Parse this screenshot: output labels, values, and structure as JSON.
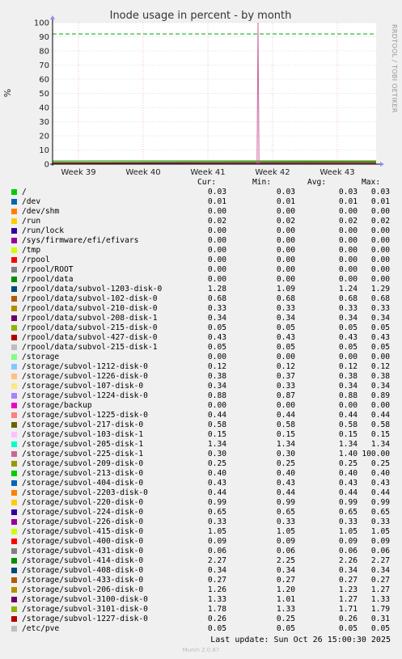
{
  "chart_data": {
    "type": "line",
    "title": "Inode usage in percent - by month",
    "ylabel": "%",
    "side_label": "RRDTOOL / TOBI OETIKER",
    "ylim": [
      0,
      100
    ],
    "yticks": [
      0,
      10,
      20,
      30,
      40,
      50,
      60,
      70,
      80,
      90,
      100
    ],
    "xlim": [
      0,
      100
    ],
    "x_ticks": [
      {
        "label": "Week 39",
        "x": 8
      },
      {
        "label": "Week 40",
        "x": 28
      },
      {
        "label": "Week 41",
        "x": 48
      },
      {
        "label": "Week 42",
        "x": 68
      },
      {
        "label": "Week 43",
        "x": 88
      }
    ],
    "warning_line": 92,
    "spike": {
      "x": 63.5,
      "y": 100
    }
  },
  "legend": {
    "headers": [
      "Cur:",
      "Min:",
      "Avg:",
      "Max:"
    ],
    "rows": [
      {
        "name": "/",
        "color": "#00cc00",
        "cur": "0.03",
        "min": "0.03",
        "avg": "0.03",
        "max": "0.03"
      },
      {
        "name": "/dev",
        "color": "#0066b3",
        "cur": "0.01",
        "min": "0.01",
        "avg": "0.01",
        "max": "0.01"
      },
      {
        "name": "/dev/shm",
        "color": "#ff8000",
        "cur": "0.00",
        "min": "0.00",
        "avg": "0.00",
        "max": "0.00"
      },
      {
        "name": "/run",
        "color": "#ffcc00",
        "cur": "0.02",
        "min": "0.02",
        "avg": "0.02",
        "max": "0.02"
      },
      {
        "name": "/run/lock",
        "color": "#330099",
        "cur": "0.00",
        "min": "0.00",
        "avg": "0.00",
        "max": "0.00"
      },
      {
        "name": "/sys/firmware/efi/efivars",
        "color": "#990099",
        "cur": "0.00",
        "min": "0.00",
        "avg": "0.00",
        "max": "0.00"
      },
      {
        "name": "/tmp",
        "color": "#ccff00",
        "cur": "0.00",
        "min": "0.00",
        "avg": "0.00",
        "max": "0.00"
      },
      {
        "name": "/rpool",
        "color": "#ff0000",
        "cur": "0.00",
        "min": "0.00",
        "avg": "0.00",
        "max": "0.00"
      },
      {
        "name": "/rpool/ROOT",
        "color": "#808080",
        "cur": "0.00",
        "min": "0.00",
        "avg": "0.00",
        "max": "0.00"
      },
      {
        "name": "/rpool/data",
        "color": "#008f00",
        "cur": "0.00",
        "min": "0.00",
        "avg": "0.00",
        "max": "0.00"
      },
      {
        "name": "/rpool/data/subvol-1203-disk-0",
        "color": "#00487d",
        "cur": "1.28",
        "min": "1.09",
        "avg": "1.24",
        "max": "1.29"
      },
      {
        "name": "/rpool/data/subvol-102-disk-0",
        "color": "#b35a00",
        "cur": "0.68",
        "min": "0.68",
        "avg": "0.68",
        "max": "0.68"
      },
      {
        "name": "/rpool/data/subvol-210-disk-0",
        "color": "#b38f00",
        "cur": "0.33",
        "min": "0.33",
        "avg": "0.33",
        "max": "0.33"
      },
      {
        "name": "/rpool/data/subvol-208-disk-1",
        "color": "#6b006b",
        "cur": "0.34",
        "min": "0.34",
        "avg": "0.34",
        "max": "0.34"
      },
      {
        "name": "/rpool/data/subvol-215-disk-0",
        "color": "#8fb300",
        "cur": "0.05",
        "min": "0.05",
        "avg": "0.05",
        "max": "0.05"
      },
      {
        "name": "/rpool/data/subvol-427-disk-0",
        "color": "#b30000",
        "cur": "0.43",
        "min": "0.43",
        "avg": "0.43",
        "max": "0.43"
      },
      {
        "name": "/rpool/data/subvol-215-disk-1",
        "color": "#bebebe",
        "cur": "0.05",
        "min": "0.05",
        "avg": "0.05",
        "max": "0.05"
      },
      {
        "name": "/storage",
        "color": "#80ff80",
        "cur": "0.00",
        "min": "0.00",
        "avg": "0.00",
        "max": "0.00"
      },
      {
        "name": "/storage/subvol-1212-disk-0",
        "color": "#80c9ff",
        "cur": "0.12",
        "min": "0.12",
        "avg": "0.12",
        "max": "0.12"
      },
      {
        "name": "/storage/subvol-1226-disk-0",
        "color": "#ffc080",
        "cur": "0.38",
        "min": "0.37",
        "avg": "0.38",
        "max": "0.38"
      },
      {
        "name": "/storage/subvol-107-disk-0",
        "color": "#ffe680",
        "cur": "0.34",
        "min": "0.33",
        "avg": "0.34",
        "max": "0.34"
      },
      {
        "name": "/storage/subvol-1224-disk-0",
        "color": "#aa80ff",
        "cur": "0.88",
        "min": "0.87",
        "avg": "0.88",
        "max": "0.89"
      },
      {
        "name": "/storage/backup",
        "color": "#ee00cc",
        "cur": "0.00",
        "min": "0.00",
        "avg": "0.00",
        "max": "0.00"
      },
      {
        "name": "/storage/subvol-1225-disk-0",
        "color": "#ff8080",
        "cur": "0.44",
        "min": "0.44",
        "avg": "0.44",
        "max": "0.44"
      },
      {
        "name": "/storage/subvol-217-disk-0",
        "color": "#666600",
        "cur": "0.58",
        "min": "0.58",
        "avg": "0.58",
        "max": "0.58"
      },
      {
        "name": "/storage/subvol-103-disk-1",
        "color": "#ffbfff",
        "cur": "0.15",
        "min": "0.15",
        "avg": "0.15",
        "max": "0.15"
      },
      {
        "name": "/storage/subvol-205-disk-1",
        "color": "#00ffcc",
        "cur": "1.34",
        "min": "1.34",
        "avg": "1.34",
        "max": "1.34"
      },
      {
        "name": "/storage/subvol-225-disk-1",
        "color": "#cc6699",
        "cur": "0.30",
        "min": "0.30",
        "avg": "1.40",
        "max": "100.00"
      },
      {
        "name": "/storage/subvol-209-disk-0",
        "color": "#999900",
        "cur": "0.25",
        "min": "0.25",
        "avg": "0.25",
        "max": "0.25"
      },
      {
        "name": "/storage/subvol-213-disk-0",
        "color": "#00cc00",
        "cur": "0.40",
        "min": "0.40",
        "avg": "0.40",
        "max": "0.40"
      },
      {
        "name": "/storage/subvol-404-disk-0",
        "color": "#0066b3",
        "cur": "0.43",
        "min": "0.43",
        "avg": "0.43",
        "max": "0.43"
      },
      {
        "name": "/storage/subvol-2203-disk-0",
        "color": "#ff8000",
        "cur": "0.44",
        "min": "0.44",
        "avg": "0.44",
        "max": "0.44"
      },
      {
        "name": "/storage/subvol-220-disk-0",
        "color": "#ffcc00",
        "cur": "0.99",
        "min": "0.99",
        "avg": "0.99",
        "max": "0.99"
      },
      {
        "name": "/storage/subvol-224-disk-0",
        "color": "#330099",
        "cur": "0.65",
        "min": "0.65",
        "avg": "0.65",
        "max": "0.65"
      },
      {
        "name": "/storage/subvol-226-disk-0",
        "color": "#990099",
        "cur": "0.33",
        "min": "0.33",
        "avg": "0.33",
        "max": "0.33"
      },
      {
        "name": "/storage/subvol-415-disk-0",
        "color": "#ccff00",
        "cur": "1.05",
        "min": "1.05",
        "avg": "1.05",
        "max": "1.05"
      },
      {
        "name": "/storage/subvol-400-disk-0",
        "color": "#ff0000",
        "cur": "0.09",
        "min": "0.09",
        "avg": "0.09",
        "max": "0.09"
      },
      {
        "name": "/storage/subvol-431-disk-0",
        "color": "#808080",
        "cur": "0.06",
        "min": "0.06",
        "avg": "0.06",
        "max": "0.06"
      },
      {
        "name": "/storage/subvol-414-disk-0",
        "color": "#008f00",
        "cur": "2.27",
        "min": "2.25",
        "avg": "2.26",
        "max": "2.27"
      },
      {
        "name": "/storage/subvol-408-disk-0",
        "color": "#00487d",
        "cur": "0.34",
        "min": "0.34",
        "avg": "0.34",
        "max": "0.34"
      },
      {
        "name": "/storage/subvol-433-disk-0",
        "color": "#b35a00",
        "cur": "0.27",
        "min": "0.27",
        "avg": "0.27",
        "max": "0.27"
      },
      {
        "name": "/storage/subvol-206-disk-0",
        "color": "#b38f00",
        "cur": "1.26",
        "min": "1.20",
        "avg": "1.23",
        "max": "1.27"
      },
      {
        "name": "/storage/subvol-3100-disk-0",
        "color": "#6b006b",
        "cur": "1.33",
        "min": "1.01",
        "avg": "1.27",
        "max": "1.33"
      },
      {
        "name": "/storage/subvol-3101-disk-0",
        "color": "#8fb300",
        "cur": "1.78",
        "min": "1.33",
        "avg": "1.71",
        "max": "1.79"
      },
      {
        "name": "/storage/subvol-1227-disk-0",
        "color": "#b30000",
        "cur": "0.26",
        "min": "0.25",
        "avg": "0.26",
        "max": "0.31"
      },
      {
        "name": "/etc/pve",
        "color": "#bebebe",
        "cur": "0.05",
        "min": "0.05",
        "avg": "0.05",
        "max": "0.05"
      }
    ]
  },
  "footer": {
    "last_update": "Last update: Sun Oct 26 15:00:30 2025",
    "version": "Munin 2.0.67"
  }
}
